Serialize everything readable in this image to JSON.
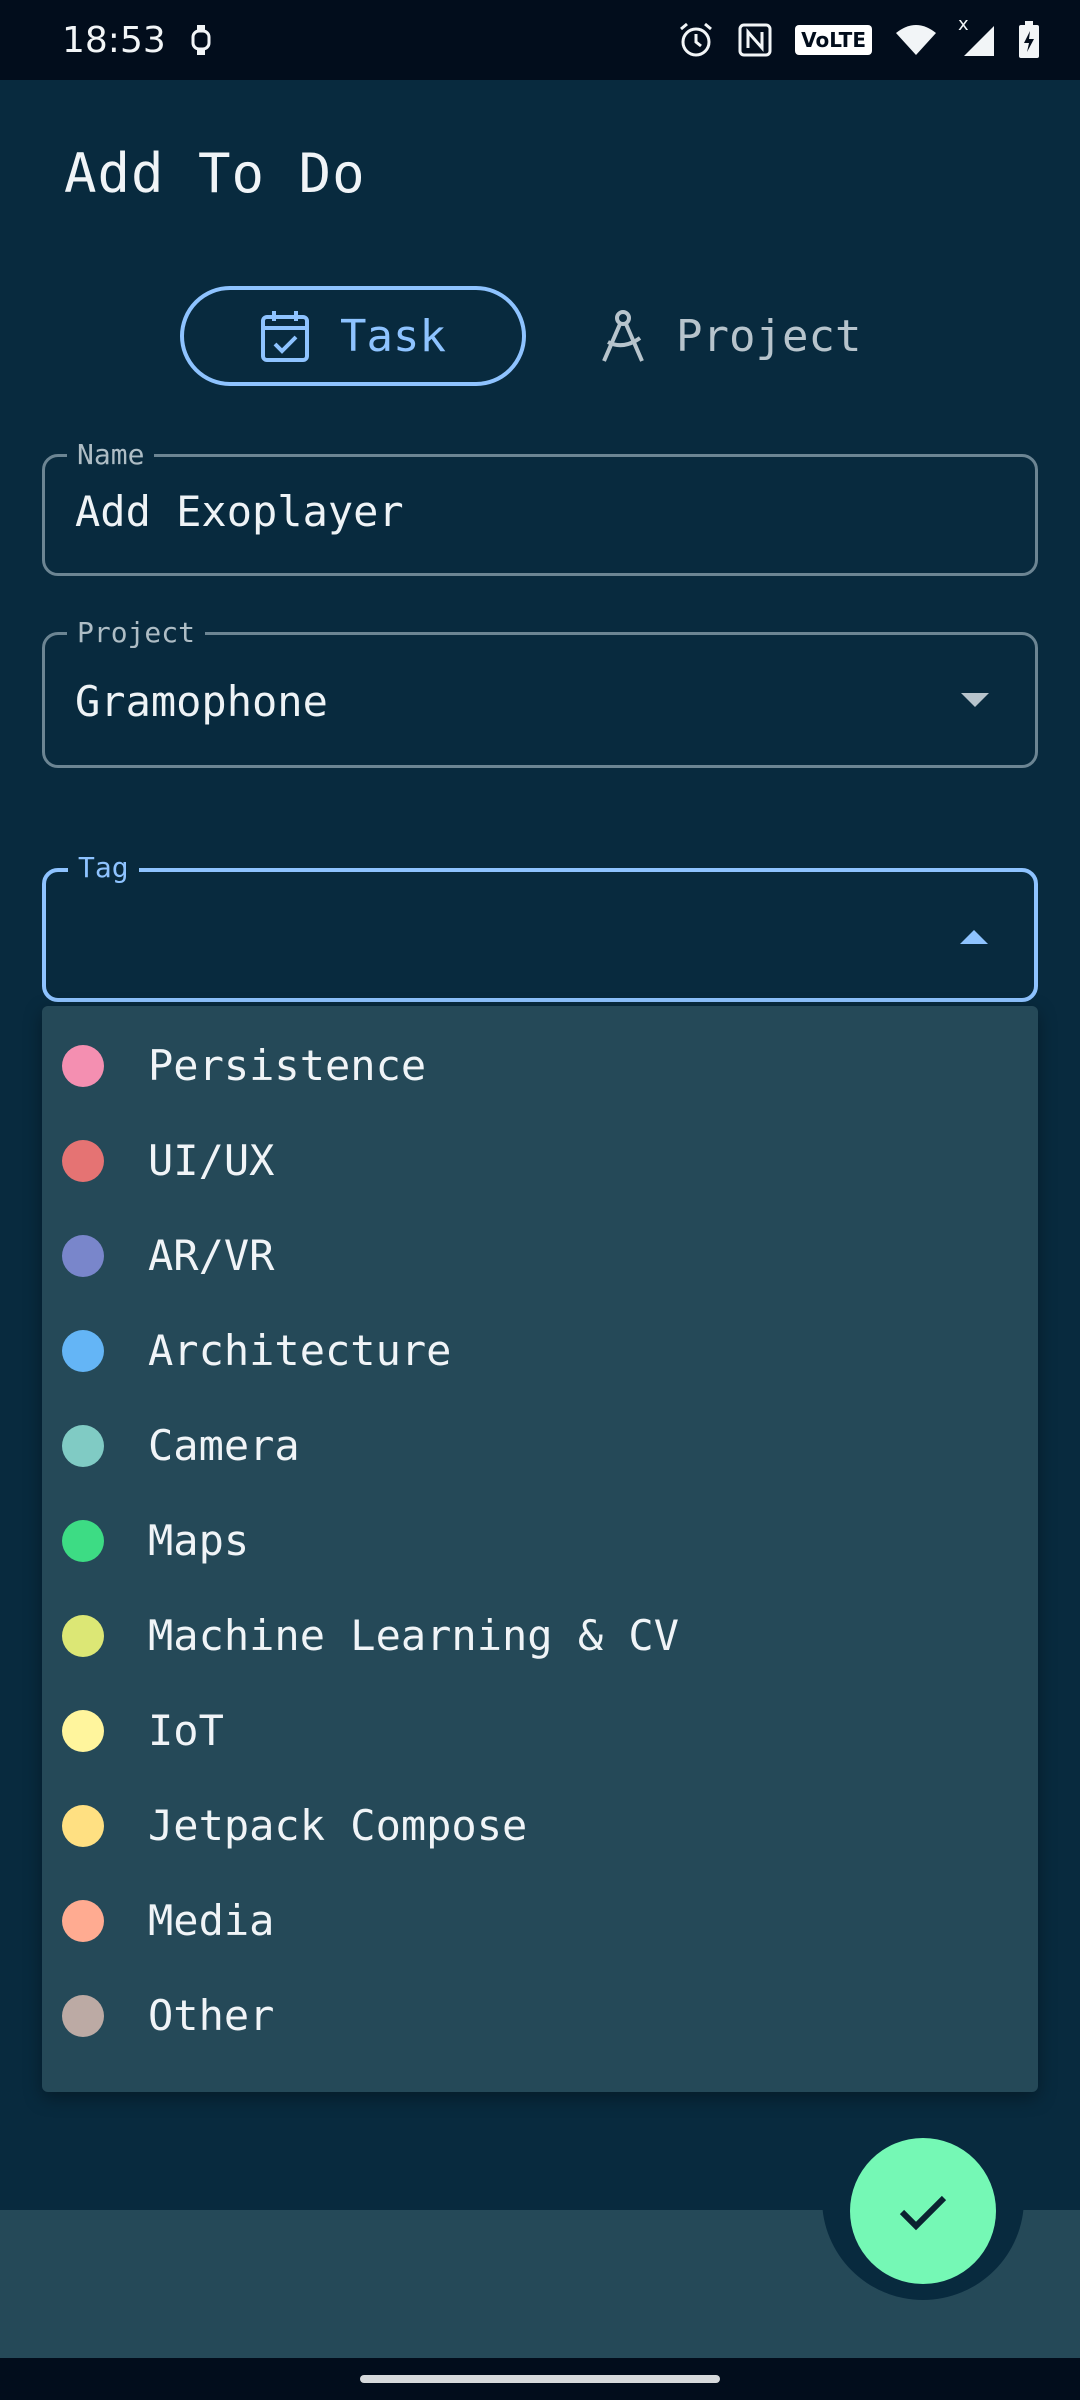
{
  "status_bar": {
    "time": "18:53",
    "icons": [
      "watch-icon",
      "alarm-icon",
      "nfc-icon",
      "volte-badge",
      "wifi-icon",
      "signal-icon",
      "battery-charging-icon"
    ],
    "volte_text": "VoLTE",
    "signal_x": "x"
  },
  "header": {
    "title": "Add To Do"
  },
  "type_toggle": {
    "task_label": "Task",
    "project_label": "Project",
    "selected": "Task"
  },
  "form": {
    "name": {
      "label": "Name",
      "value": "Add Exoplayer"
    },
    "project": {
      "label": "Project",
      "value": "Gramophone"
    },
    "tag": {
      "label": "Tag",
      "value": ""
    }
  },
  "tag_menu": {
    "items": [
      {
        "label": "Persistence",
        "color": "#f48fb1"
      },
      {
        "label": "UI/UX",
        "color": "#e57373"
      },
      {
        "label": "AR/VR",
        "color": "#7986cb"
      },
      {
        "label": "Architecture",
        "color": "#64b5f6"
      },
      {
        "label": "Camera",
        "color": "#80cbc4"
      },
      {
        "label": "Maps",
        "color": "#3ddc84"
      },
      {
        "label": "Machine Learning & CV",
        "color": "#dce775"
      },
      {
        "label": "IoT",
        "color": "#fff59d"
      },
      {
        "label": "Jetpack Compose",
        "color": "#ffe082"
      },
      {
        "label": "Media",
        "color": "#ffab91"
      },
      {
        "label": "Other",
        "color": "#bcaaa4"
      }
    ]
  },
  "colors": {
    "background": "#082a3e",
    "surface": "#254958",
    "accent": "#8ec3ff",
    "fab": "#75f8b5"
  }
}
